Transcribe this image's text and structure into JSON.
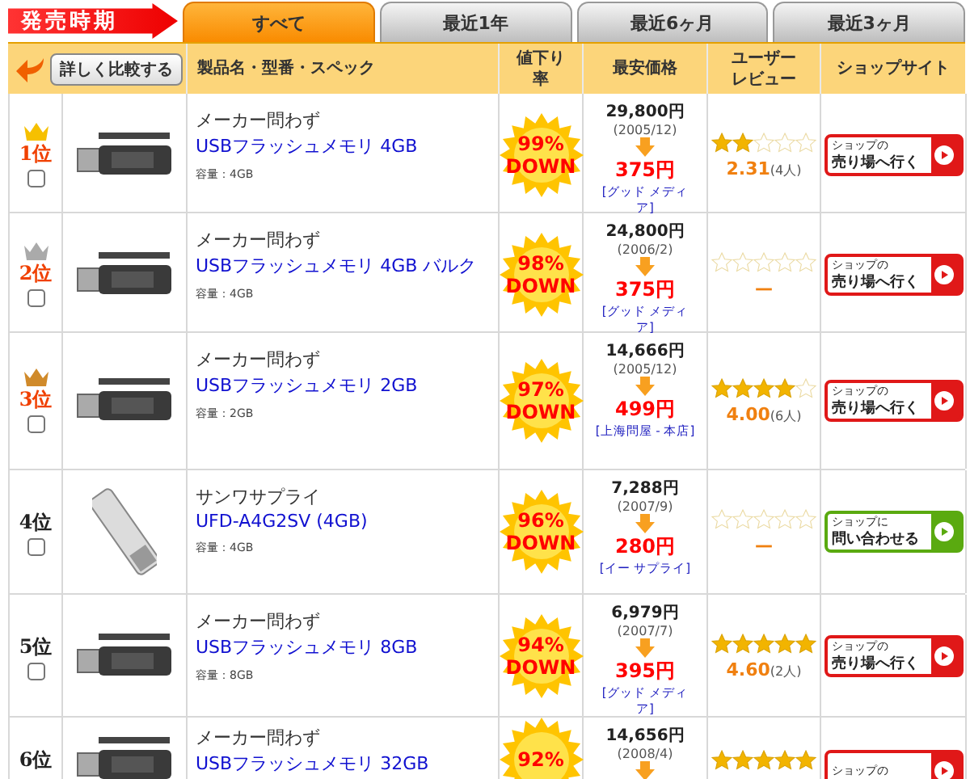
{
  "period_label": "発売時期",
  "tabs": [
    {
      "label": "すべて",
      "selected": true
    },
    {
      "label": "最近1年",
      "selected": false
    },
    {
      "label": "最近6ヶ月",
      "selected": false
    },
    {
      "label": "最近3ヶ月",
      "selected": false
    }
  ],
  "compare_button": "詳しく比較する",
  "columns": [
    "製品名・型番・スペック",
    "値下り率",
    "最安価格",
    "ユーザーレビュー",
    "ショップサイト"
  ],
  "rows": [
    {
      "rank": "1位",
      "checked": false,
      "maker": "メーカー問わず",
      "name": "USBフラッシュメモリ 4GB",
      "spec": "容量：4GB",
      "discount": "99%",
      "down": "DOWN",
      "old_price": "29,800円",
      "date": "(2005/12)",
      "price": "375円",
      "shop": "[グッド メディア]",
      "stars": 2,
      "rating": "2.31",
      "reviews": "(4人)",
      "shop_button": {
        "kind": "go",
        "line1": "ショップの",
        "line2": "売り場へ行く"
      }
    },
    {
      "rank": "2位",
      "checked": false,
      "maker": "メーカー問わず",
      "name": "USBフラッシュメモリ 4GB バルク",
      "spec": "容量：4GB",
      "discount": "98%",
      "down": "DOWN",
      "old_price": "24,800円",
      "date": "(2006/2)",
      "price": "375円",
      "shop": "[グッド メディア]",
      "stars": 0,
      "rating": "—",
      "shop_button": {
        "kind": "go",
        "line1": "ショップの",
        "line2": "売り場へ行く"
      }
    },
    {
      "rank": "3位",
      "checked": false,
      "maker": "メーカー問わず",
      "name": "USBフラッシュメモリ 2GB",
      "spec": "容量：2GB",
      "discount": "97%",
      "down": "DOWN",
      "old_price": "14,666円",
      "date": "(2005/12)",
      "price": "499円",
      "shop": "[上海問屋 - 本店]",
      "stars": 4,
      "rating": "4.00",
      "reviews": "(6人)",
      "shop_button": {
        "kind": "go",
        "line1": "ショップの",
        "line2": "売り場へ行く"
      }
    },
    {
      "rank": "4位",
      "checked": false,
      "maker": "サンワサプライ",
      "name": "UFD-A4G2SV (4GB)",
      "spec": "容量：4GB",
      "discount": "96%",
      "down": "DOWN",
      "old_price": "7,288円",
      "date": "(2007/9)",
      "price": "280円",
      "shop": "[イー サプライ]",
      "stars": 0,
      "rating": "—",
      "shop_button": {
        "kind": "ask",
        "line1": "ショップに",
        "line2": "問い合わせる"
      }
    },
    {
      "rank": "5位",
      "checked": false,
      "maker": "メーカー問わず",
      "name": "USBフラッシュメモリ 8GB",
      "spec": "容量：8GB",
      "discount": "94%",
      "down": "DOWN",
      "old_price": "6,979円",
      "date": "(2007/7)",
      "price": "395円",
      "shop": "[グッド メディア]",
      "stars": 5,
      "rating": "4.60",
      "reviews": "(2人)",
      "shop_button": {
        "kind": "go",
        "line1": "ショップの",
        "line2": "売り場へ行く"
      }
    },
    {
      "rank": "6位",
      "maker": "メーカー問わず",
      "name": "USBフラッシュメモリ 32GB",
      "discount": "92%",
      "old_price": "14,656円",
      "date": "(2008/4)",
      "stars": 5,
      "shop_button": {
        "kind": "go",
        "line1": "ショップの"
      }
    }
  ]
}
